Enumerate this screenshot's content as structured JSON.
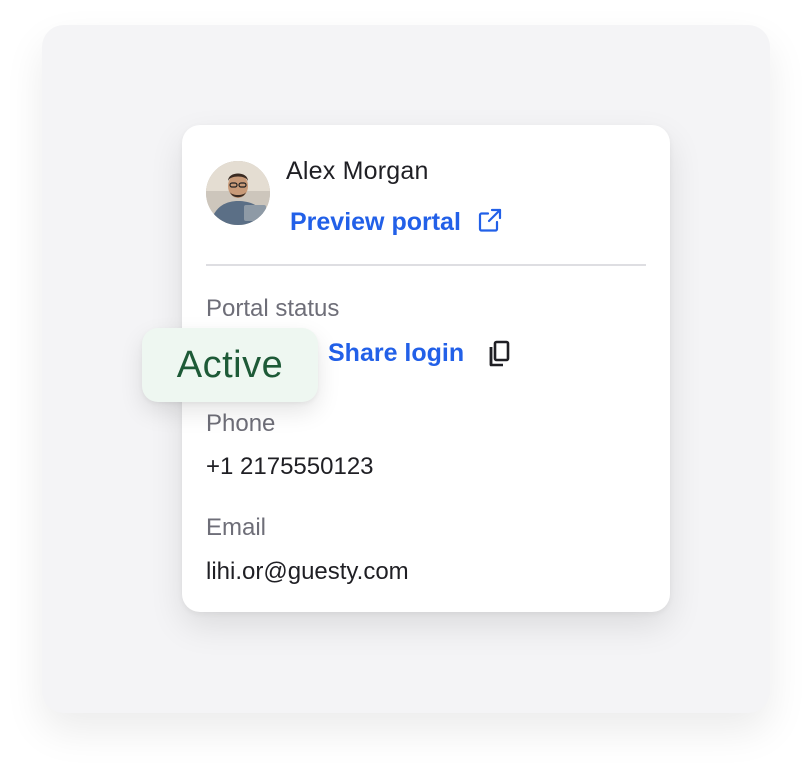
{
  "contact": {
    "name": "Alex Morgan",
    "preview_label": "Preview portal",
    "avatar_alt": "avatar"
  },
  "portal": {
    "status_label": "Portal status",
    "status_value": "Active",
    "share_label": "Share login"
  },
  "phone": {
    "label": "Phone",
    "value": "+1 2175550123"
  },
  "email": {
    "label": "Email",
    "value": "lihi.or@guesty.com"
  },
  "icons": {
    "preview": "external-link-icon",
    "share": "copy-icon"
  },
  "colors": {
    "link": "#2260e8",
    "badge_bg": "#eef7f1",
    "badge_text": "#1d5a37"
  }
}
